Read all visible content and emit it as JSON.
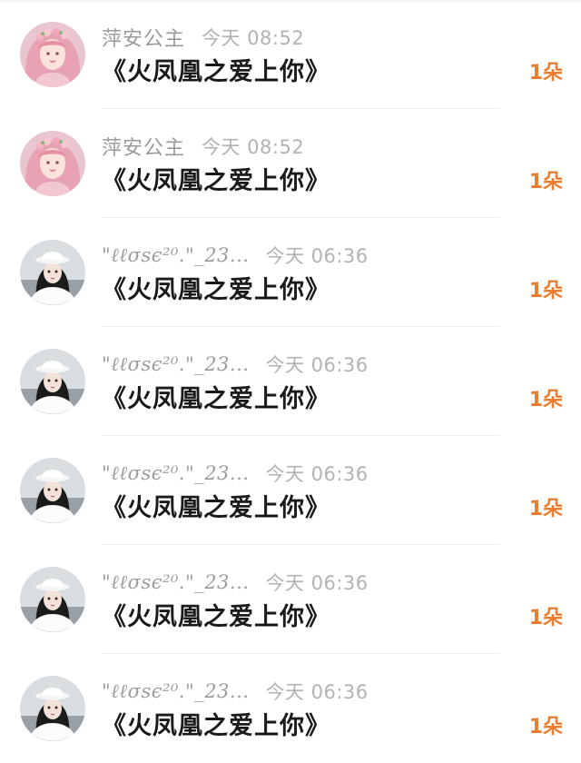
{
  "messages": [
    {
      "name": "萍安公主",
      "time": "今天 08:52",
      "title": "《火凤凰之爱上你》",
      "count": "1朵",
      "avatar": "pink-hair-avatar"
    },
    {
      "name": "萍安公主",
      "time": "今天 08:52",
      "title": "《火凤凰之爱上你》",
      "count": "1朵",
      "avatar": "pink-hair-avatar"
    },
    {
      "name": "\"ℓℓσѕє²⁰.\"_23...",
      "time": "今天 06:36",
      "title": "《火凤凰之爱上你》",
      "count": "1朵",
      "avatar": "white-hat-avatar"
    },
    {
      "name": "\"ℓℓσѕє²⁰.\"_23...",
      "time": "今天 06:36",
      "title": "《火凤凰之爱上你》",
      "count": "1朵",
      "avatar": "white-hat-avatar"
    },
    {
      "name": "\"ℓℓσѕє²⁰.\"_23...",
      "time": "今天 06:36",
      "title": "《火凤凰之爱上你》",
      "count": "1朵",
      "avatar": "white-hat-avatar"
    },
    {
      "name": "\"ℓℓσѕє²⁰.\"_23...",
      "time": "今天 06:36",
      "title": "《火凤凰之爱上你》",
      "count": "1朵",
      "avatar": "white-hat-avatar"
    },
    {
      "name": "\"ℓℓσѕє²⁰.\"_23...",
      "time": "今天 06:36",
      "title": "《火凤凰之爱上你》",
      "count": "1朵",
      "avatar": "white-hat-avatar"
    }
  ],
  "colors": {
    "count": "#ee7a2c",
    "name": "#9b9b9b",
    "time": "#b3b3b3",
    "title": "#1a1a1a"
  }
}
